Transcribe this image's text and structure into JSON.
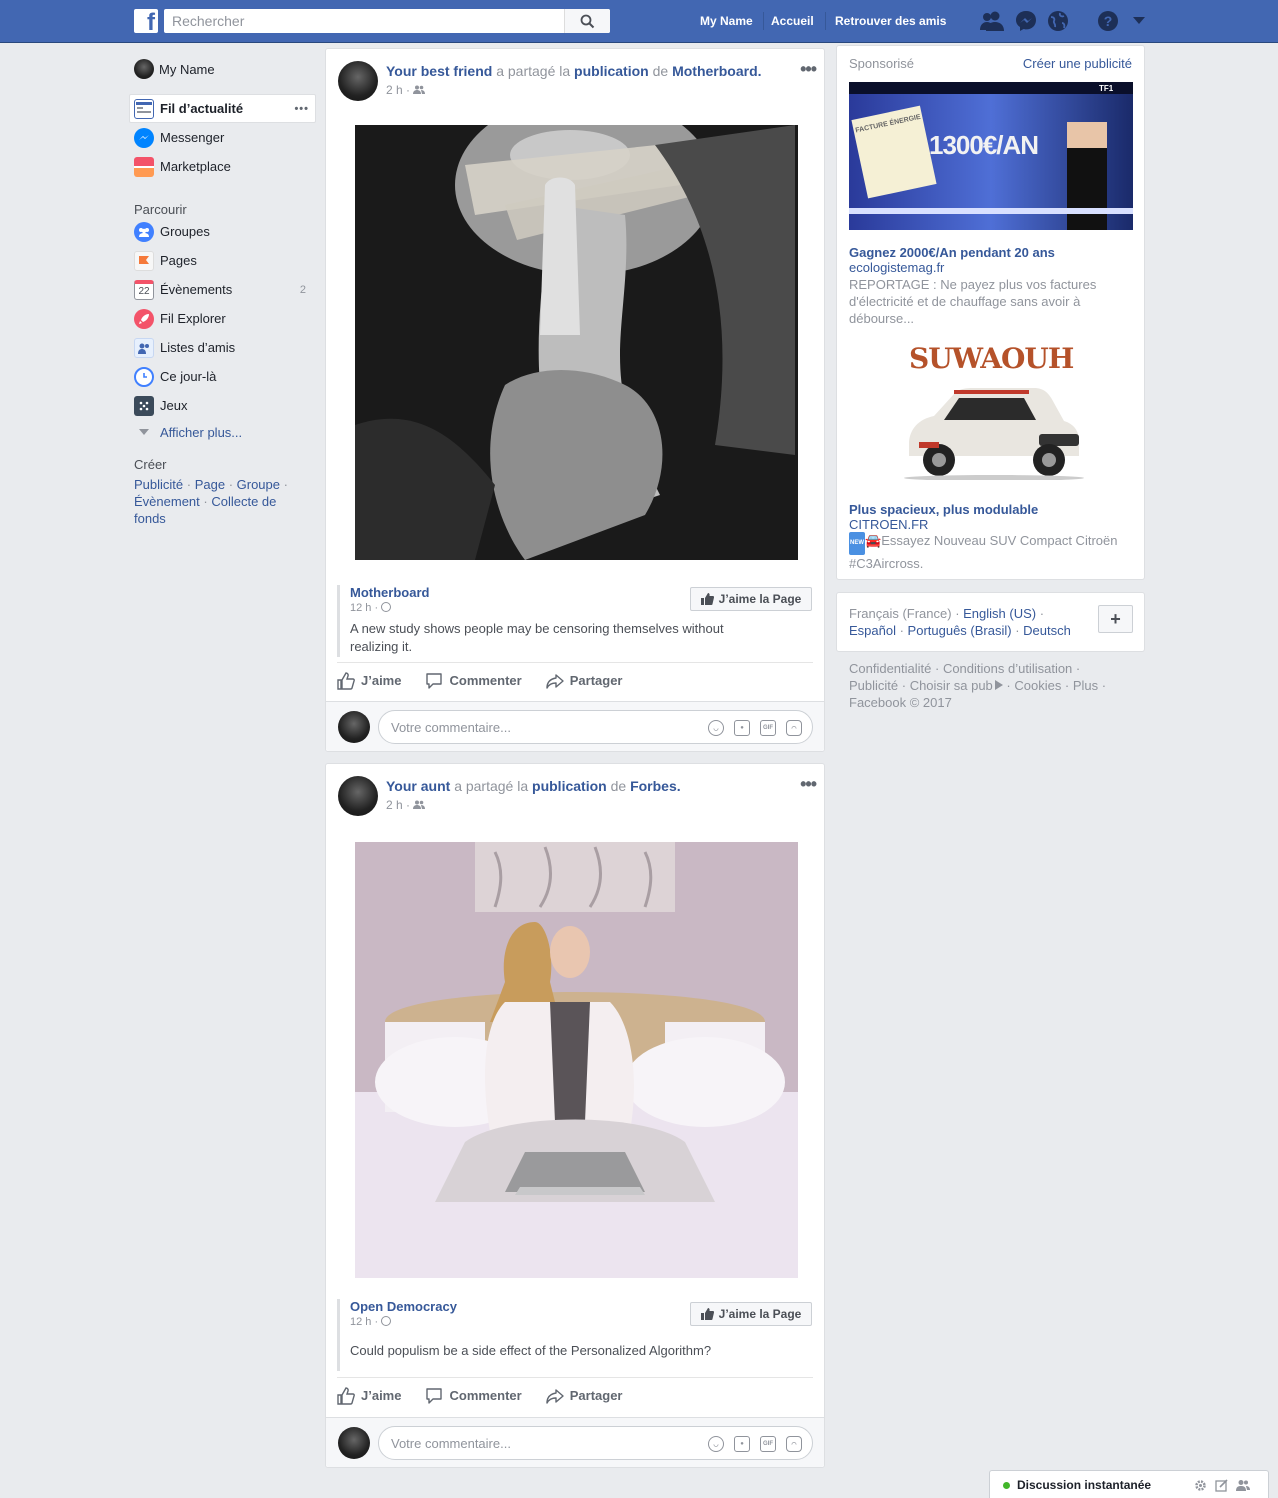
{
  "topbar": {
    "logo": "f",
    "search_placeholder": "Rechercher",
    "user_name": "My Name",
    "home_label": "Accueil",
    "find_friends_label": "Retrouver des amis",
    "icons": [
      "friend-requests-icon",
      "messenger-icon",
      "notifications-globe-icon",
      "help-icon",
      "account-menu-chevron-icon"
    ]
  },
  "sidebar": {
    "profile_name": "My Name",
    "main_items": [
      {
        "label": "Fil d’actualité",
        "icon": "news-feed-icon",
        "more": "•••"
      },
      {
        "label": "Messenger",
        "icon": "messenger-icon"
      },
      {
        "label": "Marketplace",
        "icon": "marketplace-icon"
      }
    ],
    "explore_heading": "Parcourir",
    "explore_items": [
      {
        "label": "Groupes",
        "icon": "groups-icon"
      },
      {
        "label": "Pages",
        "icon": "pages-flag-icon"
      },
      {
        "label": "Évènements",
        "icon": "events-calendar-icon",
        "calendar_day": "22",
        "count": "2"
      },
      {
        "label": "Fil Explorer",
        "icon": "explore-feed-rocket-icon"
      },
      {
        "label": "Listes d’amis",
        "icon": "friend-lists-icon"
      },
      {
        "label": "Ce jour-là",
        "icon": "on-this-day-icon"
      },
      {
        "label": "Jeux",
        "icon": "games-icon"
      }
    ],
    "show_more": "Afficher plus...",
    "create_heading": "Créer",
    "create_links": [
      "Publicité",
      "Page",
      "Groupe",
      "Évènement",
      "Collecte de fonds"
    ]
  },
  "posts": [
    {
      "sharer": "Your best friend",
      "shared_text": "a partagé la",
      "publication": "publication",
      "of": "de",
      "source": "Motherboard.",
      "time": "2 h ·",
      "more": "•••",
      "shared_source": "Motherboard",
      "shared_time": "12 h ·",
      "shared_text_body": "A new study shows people may be censoring themselves without realizing it.",
      "like_page": "J’aime la Page"
    },
    {
      "sharer": "Your aunt",
      "shared_text": "a partagé la",
      "publication": "publication",
      "of": "de",
      "source": "Forbes.",
      "time": "2 h ·",
      "more": "•••",
      "shared_source": "Open Democracy",
      "shared_time": "12 h ·",
      "shared_text_body": "Could populism be a side effect of the Personalized Algorithm?",
      "like_page": "J’aime la Page"
    }
  ],
  "actions": {
    "like": "J’aime",
    "comment": "Commenter",
    "share": "Partager"
  },
  "comment_placeholder": "Votre commentaire...",
  "comment_icons": {
    "gif": "GIF"
  },
  "sponsored": {
    "heading": "Sponsorisé",
    "create_ad": "Créer une publicité",
    "ads": [
      {
        "image_text": "1300€/AN",
        "image_stamp": "FACTURE ÉNERGIE",
        "image_channel": "TF1",
        "title": "Gagnez 2000€/An pendant 20 ans",
        "domain": "ecologistemag.fr",
        "text": "REPORTAGE : Ne payez plus vos factures d'électricité et de chauffage sans avoir à débourse..."
      },
      {
        "image_text": "SUWAOUH",
        "title": "Plus spacieux, plus modulable",
        "domain": "CITROEN.FR",
        "badge": "NEW",
        "text": "Essayez Nouveau SUV Compact Citroën #C3Aircross."
      }
    ]
  },
  "languages": {
    "current": "Français (France)",
    "links": [
      "English (US)",
      "Español",
      "Português (Brasil)",
      "Deutsch"
    ],
    "add": "+"
  },
  "footer": {
    "line1": "Confidentialité · Conditions d’utilisation ·",
    "line2": "Publicité · Choisir sa pub",
    "line2b": " · Cookies · Plus ·",
    "line3": "Facebook © 2017"
  },
  "chat": {
    "label": "Discussion instantanée"
  },
  "colors": {
    "brand": "#4267b2",
    "link": "#365899",
    "background": "#e9ebee",
    "online": "#42b72a"
  }
}
